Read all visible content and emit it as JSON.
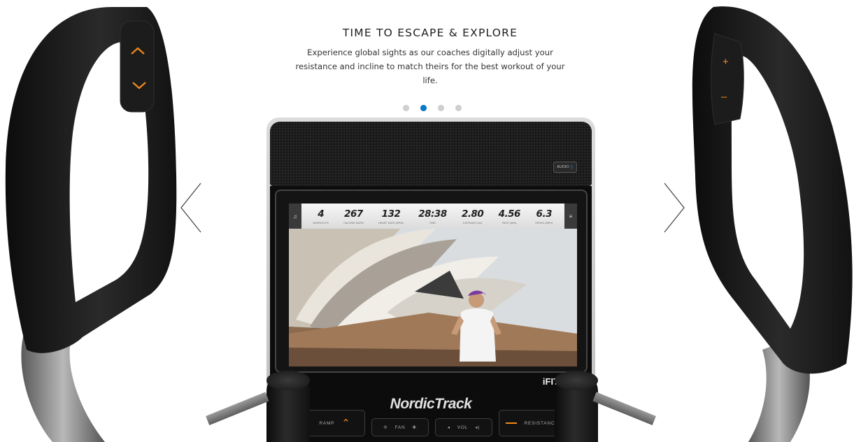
{
  "hero": {
    "title": "TIME TO ESCAPE & EXPLORE",
    "body": "Experience global sights as our coaches digitally adjust your resistance and incline to match theirs for the best workout of your life."
  },
  "carousel": {
    "dots": 4,
    "active_index": 1,
    "active_color": "#0a79c8",
    "inactive_color": "#cfcfcf",
    "prev_icon": "chevron-left-icon",
    "next_icon": "chevron-right-icon"
  },
  "left_handle": {
    "up_icon": "chevron-up-icon",
    "down_icon": "chevron-down-icon"
  },
  "right_handle": {
    "plus_label": "+",
    "minus_label": "–"
  },
  "console": {
    "audio_label": "AUDIO",
    "audio_icon": "bluetooth-icon",
    "stats": [
      {
        "value": "4",
        "label": "WORKOUTS"
      },
      {
        "value": "267",
        "label": "CALORIE BURN"
      },
      {
        "value": "132",
        "label": "HEART RATE (BPM)"
      },
      {
        "value": "28:38",
        "label": "TIME"
      },
      {
        "value": "2.80",
        "label": "DISTANCE (MI)"
      },
      {
        "value": "4.56",
        "label": "PACE (MIN)"
      },
      {
        "value": "6.3",
        "label": "SPEED (MPH)"
      }
    ],
    "ifit_label": "iFIT",
    "brand": "NordicTrack",
    "controls": {
      "incline": "RAMP",
      "fan": "FAN",
      "vol": "VOL",
      "resistance": "RESISTANCE"
    },
    "accent": "#f08a1c"
  }
}
